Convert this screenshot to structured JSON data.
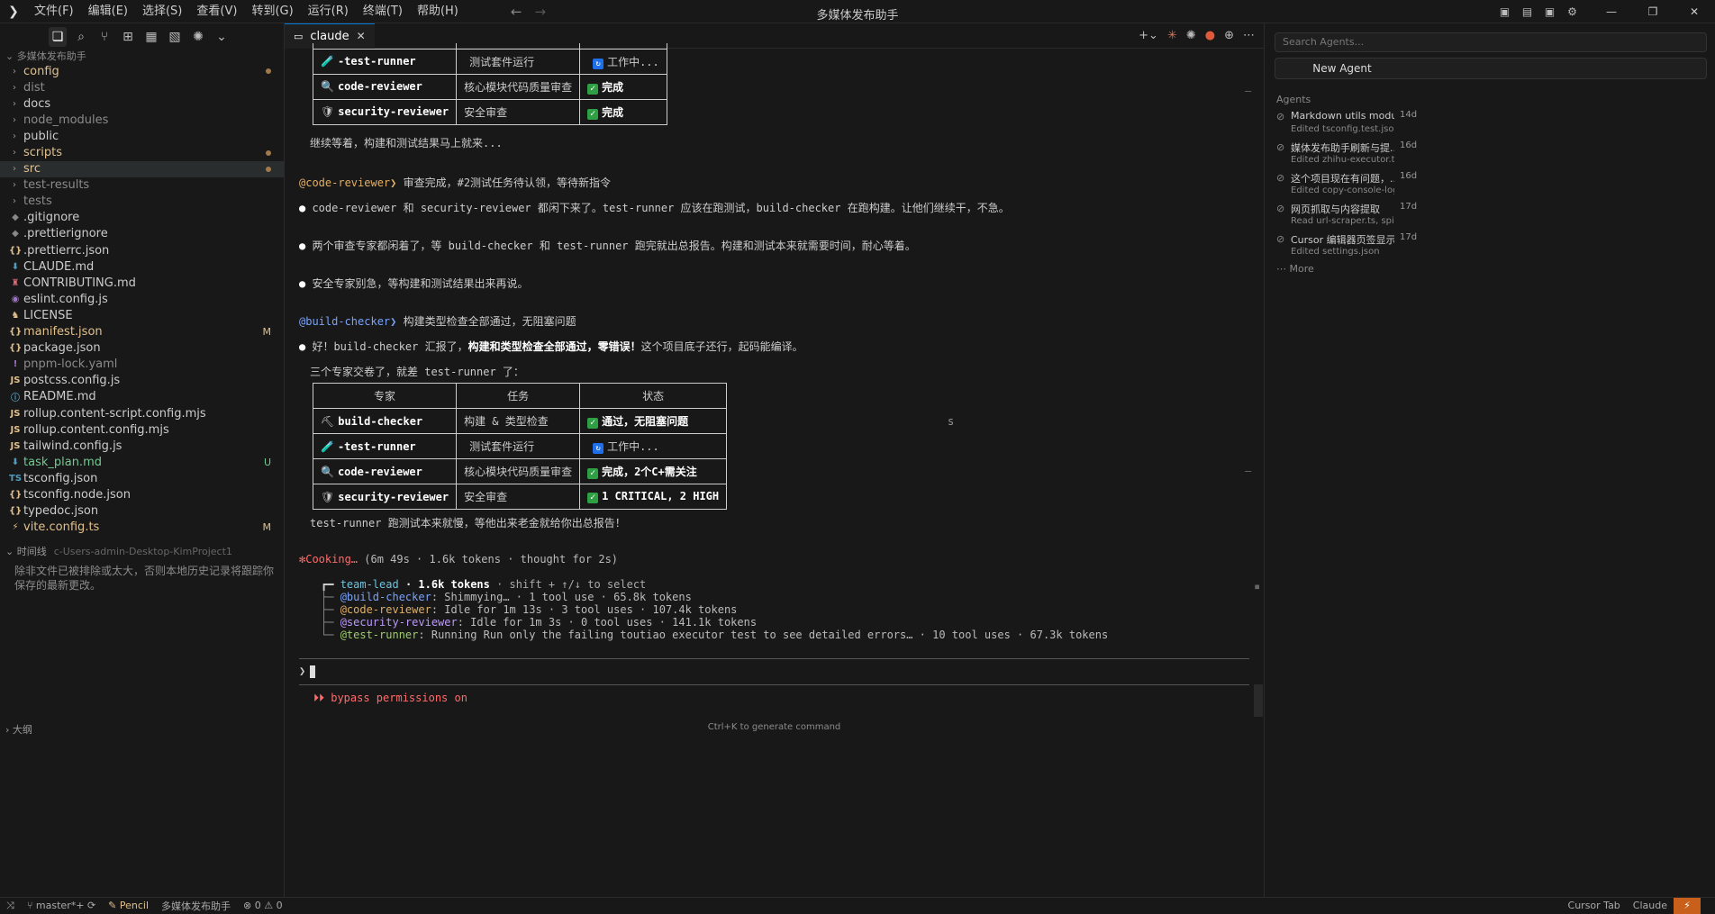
{
  "titlebar": {
    "menus": [
      "文件(F)",
      "编辑(E)",
      "选择(S)",
      "查看(V)",
      "转到(G)",
      "运行(R)",
      "终端(T)",
      "帮助(H)"
    ],
    "title": "多媒体发布助手"
  },
  "sidebar": {
    "project": "多媒体发布助手",
    "files": [
      {
        "name": "config",
        "kind": "folder",
        "color": "orange",
        "mark": "dot"
      },
      {
        "name": "dist",
        "kind": "folder",
        "color": "gray",
        "mark": ""
      },
      {
        "name": "docs",
        "kind": "folder",
        "color": "normal",
        "mark": ""
      },
      {
        "name": "node_modules",
        "kind": "folder",
        "color": "gray",
        "mark": ""
      },
      {
        "name": "public",
        "kind": "folder",
        "color": "normal",
        "mark": ""
      },
      {
        "name": "scripts",
        "kind": "folder",
        "color": "orange",
        "mark": "dot"
      },
      {
        "name": "src",
        "kind": "folder",
        "color": "orange",
        "mark": "dot",
        "selected": true
      },
      {
        "name": "test-results",
        "kind": "folder",
        "color": "gray",
        "mark": ""
      },
      {
        "name": "tests",
        "kind": "folder",
        "color": "gray",
        "mark": ""
      },
      {
        "name": ".gitignore",
        "kind": "file",
        "icon": "◆",
        "iconColor": "#888",
        "color": "normal",
        "mark": ""
      },
      {
        "name": ".prettierignore",
        "kind": "file",
        "icon": "◆",
        "iconColor": "#888",
        "color": "normal",
        "mark": ""
      },
      {
        "name": ".prettierrc.json",
        "kind": "file",
        "icon": "{}",
        "iconColor": "#e2c08d",
        "color": "normal",
        "mark": ""
      },
      {
        "name": "CLAUDE.md",
        "kind": "file",
        "icon": "⬇",
        "iconColor": "#519aba",
        "color": "normal",
        "mark": ""
      },
      {
        "name": "CONTRIBUTING.md",
        "kind": "file",
        "icon": "♜",
        "iconColor": "#e06c75",
        "color": "normal",
        "mark": ""
      },
      {
        "name": "eslint.config.js",
        "kind": "file",
        "icon": "◉",
        "iconColor": "#a074c4",
        "color": "normal",
        "mark": ""
      },
      {
        "name": "LICENSE",
        "kind": "file",
        "icon": "♞",
        "iconColor": "#e2c08d",
        "color": "normal",
        "mark": ""
      },
      {
        "name": "manifest.json",
        "kind": "file",
        "icon": "{}",
        "iconColor": "#e2c08d",
        "color": "orange",
        "mark": "M"
      },
      {
        "name": "package.json",
        "kind": "file",
        "icon": "{}",
        "iconColor": "#e2c08d",
        "color": "normal",
        "mark": ""
      },
      {
        "name": "pnpm-lock.yaml",
        "kind": "file",
        "icon": "!",
        "iconColor": "#a074c4",
        "color": "gray",
        "mark": ""
      },
      {
        "name": "postcss.config.js",
        "kind": "file",
        "icon": "JS",
        "iconColor": "#e2c08d",
        "color": "normal",
        "mark": ""
      },
      {
        "name": "README.md",
        "kind": "file",
        "icon": "ⓘ",
        "iconColor": "#519aba",
        "color": "normal",
        "mark": ""
      },
      {
        "name": "rollup.content-script.config.mjs",
        "kind": "file",
        "icon": "JS",
        "iconColor": "#e2c08d",
        "color": "normal",
        "mark": ""
      },
      {
        "name": "rollup.content.config.mjs",
        "kind": "file",
        "icon": "JS",
        "iconColor": "#e2c08d",
        "color": "normal",
        "mark": ""
      },
      {
        "name": "tailwind.config.js",
        "kind": "file",
        "icon": "JS",
        "iconColor": "#e2c08d",
        "color": "normal",
        "mark": ""
      },
      {
        "name": "task_plan.md",
        "kind": "file",
        "icon": "⬇",
        "iconColor": "#519aba",
        "color": "green",
        "mark": "U"
      },
      {
        "name": "tsconfig.json",
        "kind": "file",
        "icon": "TS",
        "iconColor": "#519aba",
        "color": "normal",
        "mark": ""
      },
      {
        "name": "tsconfig.node.json",
        "kind": "file",
        "icon": "{}",
        "iconColor": "#e2c08d",
        "color": "normal",
        "mark": ""
      },
      {
        "name": "typedoc.json",
        "kind": "file",
        "icon": "{}",
        "iconColor": "#e2c08d",
        "color": "normal",
        "mark": ""
      },
      {
        "name": "vite.config.ts",
        "kind": "file",
        "icon": "⚡",
        "iconColor": "#e2c08d",
        "color": "orange",
        "mark": "M"
      }
    ],
    "timeline_label": "时间线",
    "timeline_path": "c-Users-admin-Desktop-KimProject1",
    "timeline_message": "除非文件已被排除或太大，否则本地历史记录将跟踪你保存的最新更改。",
    "outline_label": "大纲"
  },
  "editor": {
    "tab_label": "claude",
    "term": {
      "t1_rows": [
        {
          "icon": "🧪",
          "agent": "-test-runner",
          "task": "测试套件运行",
          "status": "工作中...",
          "state": "work"
        },
        {
          "icon": "🔍",
          "agent": "code-reviewer",
          "task": "核心模块代码质量审查",
          "status": "完成",
          "state": "done"
        },
        {
          "icon": "🛡",
          "agent": "security-reviewer",
          "task": "安全审查",
          "status": "完成",
          "state": "done"
        }
      ],
      "line_wait": "继续等着，构建和测试结果马上就来...",
      "cr_tag": "@code-reviewer❯",
      "cr_msg": " 审查完成，#2测试任务待认领，等待新指令",
      "b1": "code-reviewer 和 security-reviewer 都闲下来了。test-runner 应该在跑测试，build-checker 在跑构建。让他们继续干，不急。",
      "b2": "两个审查专家都闲着了，等 build-checker 和 test-runner 跑完就出总报告。构建和测试本来就需要时间，耐心等着。",
      "b3": "安全专家别急，等构建和测试结果出来再说。",
      "bc_tag": "@build-checker❯",
      "bc_msg": " 构建类型检查全部通过，无阻塞问题",
      "b4_a": "好！build-checker 汇报了，",
      "b4_b": "构建和类型检查全部通过，零错误！",
      "b4_c": "这个项目底子还行，起码能编译。",
      "line_three": "三个专家交卷了，就差 test-runner 了：",
      "t2_head": [
        "专家",
        "任务",
        "状态"
      ],
      "t2_rows": [
        {
          "icon": "⛏",
          "agent": "build-checker",
          "task": "构建 & 类型检查",
          "status": "通过，无阻塞问题",
          "state": "done"
        },
        {
          "icon": "🧪",
          "agent": "-test-runner",
          "task": "测试套件运行",
          "status": "工作中...",
          "state": "work"
        },
        {
          "icon": "🔍",
          "agent": "code-reviewer",
          "task": "核心模块代码质量审查",
          "status": "完成，2个C+需关注",
          "state": "done"
        },
        {
          "icon": "🛡",
          "agent": "security-reviewer",
          "task": "安全审查",
          "status": "1 CRITICAL, 2 HIGH",
          "state": "done"
        }
      ],
      "stray_s": "s",
      "line_slow": "test-runner 跑测试本来就慢，等他出来老金就给你出总报告！",
      "cooking": "✻Cooking…",
      "cooking_meta": " (6m 49s · 1.6k tokens · thought for 2s)",
      "lead_name": "team-lead",
      "lead_tokens": " · 1.6k tokens",
      "lead_hint": " · shift + ↑/↓ to select",
      "sub": [
        {
          "name": "@build-checker",
          "color": "blue",
          "rest": ": Shimmying… · 1 tool use · 65.8k tokens"
        },
        {
          "name": "@code-reviewer",
          "color": "yellow",
          "rest": ": Idle for 1m 13s · 3 tool uses · 107.4k tokens"
        },
        {
          "name": "@security-reviewer",
          "color": "purple",
          "rest": ": Idle for 1m 3s · 0 tool uses · 141.1k tokens"
        },
        {
          "name": "@test-runner",
          "color": "green",
          "rest": ": Running Run only the failing toutiao executor test to see detailed errors… · 10 tool uses · 67.3k tokens"
        }
      ],
      "prompt": "❯",
      "bypass": "⏵⏵ bypass permissions on"
    },
    "cmd_hint": "Ctrl+K to generate command"
  },
  "agents": {
    "search_placeholder": "Search Agents...",
    "new_button": "New Agent",
    "section": "Agents",
    "items": [
      {
        "title": "Markdown utils module...",
        "desc": "Edited tsconfig.test.json",
        "age": "14d"
      },
      {
        "title": "媒体发布助手刷新与提...",
        "desc": "Edited zhihu-executor.ts, ...",
        "age": "16d"
      },
      {
        "title": "这个项目现在有问题，...",
        "desc": "Edited copy-console-log....",
        "age": "16d"
      },
      {
        "title": "网页抓取与内容提取",
        "desc": "Read url-scraper.ts, spider...",
        "age": "17d"
      },
      {
        "title": "Cursor 编辑器页签显示",
        "desc": "Edited settings.json",
        "age": "17d"
      }
    ],
    "more": "More"
  },
  "statusbar": {
    "branch": "master*+",
    "pencil": "Pencil",
    "project": "多媒体发布助手",
    "problems": "⊗ 0 ⚠ 0",
    "cursor_tab": "Cursor Tab",
    "claude": "Claude"
  }
}
